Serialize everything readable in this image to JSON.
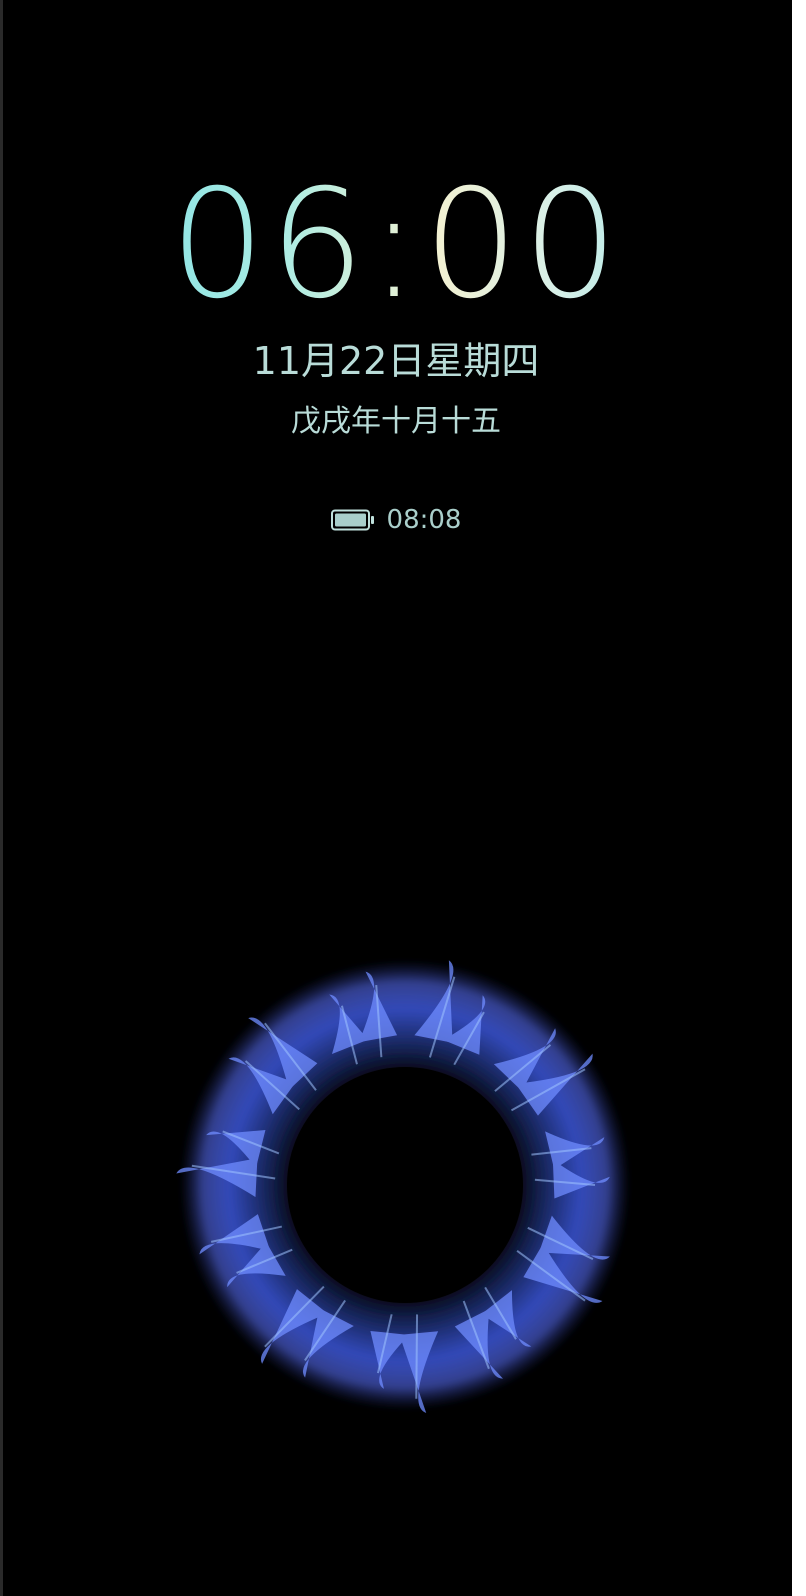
{
  "lockscreen": {
    "time": "06:00",
    "date": "11月22日星期四",
    "lunar_date": "戊戌年十月十五",
    "battery_icon": "battery-full-icon",
    "battery_time": "08:08"
  },
  "colors": {
    "background": "#000000",
    "clock_gradient": [
      "#6fdbe6",
      "#f3f1d2",
      "#7fe0e8"
    ],
    "text": "#b9dcd8",
    "orb": "#5a6cff"
  }
}
